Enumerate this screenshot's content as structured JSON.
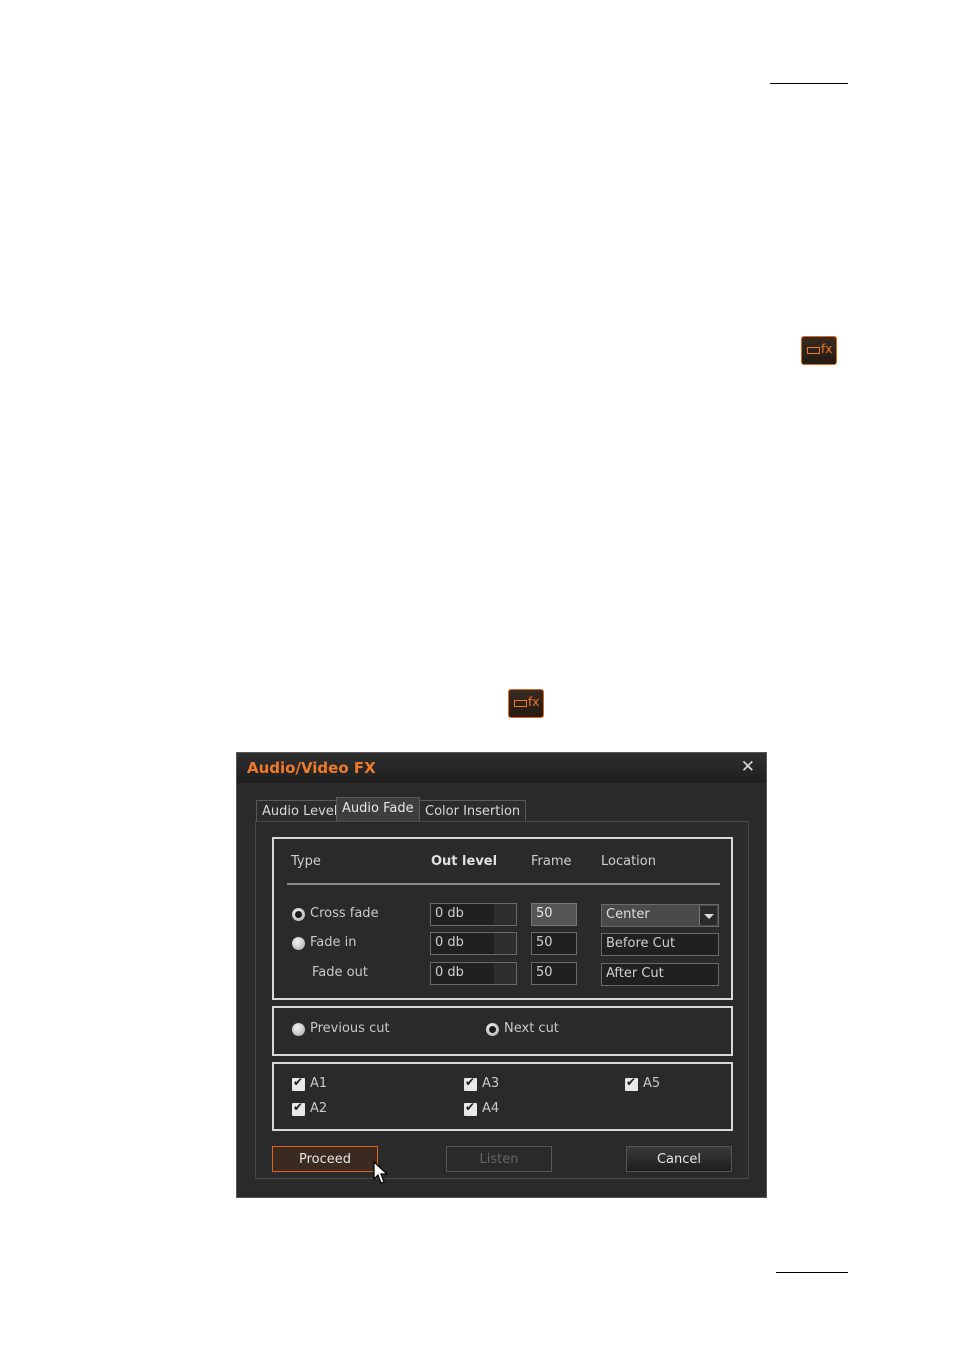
{
  "window": {
    "title": "Audio/Video FX",
    "close_glyph": "✕"
  },
  "icons": {
    "fx_button_icon": "fx",
    "accent_color": "#f07a2a"
  },
  "tabs": [
    {
      "label": "Audio Level",
      "active": false
    },
    {
      "label": "Audio Fade",
      "active": true
    },
    {
      "label": "Color Insertion",
      "active": false
    }
  ],
  "fade": {
    "headers": {
      "type": "Type",
      "out_level": "Out level",
      "frame": "Frame",
      "location": "Location"
    },
    "rows": [
      {
        "label": "Cross fade",
        "radio": true,
        "selected": true,
        "out_level": "0 db",
        "frame": "50",
        "location": "Center"
      },
      {
        "label": "Fade in",
        "radio": true,
        "selected": false,
        "out_level": "0 db",
        "frame": "50",
        "location": "Before Cut"
      },
      {
        "label": "Fade out",
        "radio": false,
        "selected": false,
        "out_level": "0 db",
        "frame": "50",
        "location": "After Cut"
      }
    ]
  },
  "cut": {
    "previous": {
      "label": "Previous cut",
      "selected": false
    },
    "next": {
      "label": "Next cut",
      "selected": true
    }
  },
  "tracks": [
    {
      "label": "A1",
      "checked": true
    },
    {
      "label": "A2",
      "checked": true
    },
    {
      "label": "A3",
      "checked": true
    },
    {
      "label": "A4",
      "checked": true
    },
    {
      "label": "A5",
      "checked": true
    }
  ],
  "buttons": {
    "proceed": "Proceed",
    "listen": "Listen",
    "cancel": "Cancel"
  }
}
